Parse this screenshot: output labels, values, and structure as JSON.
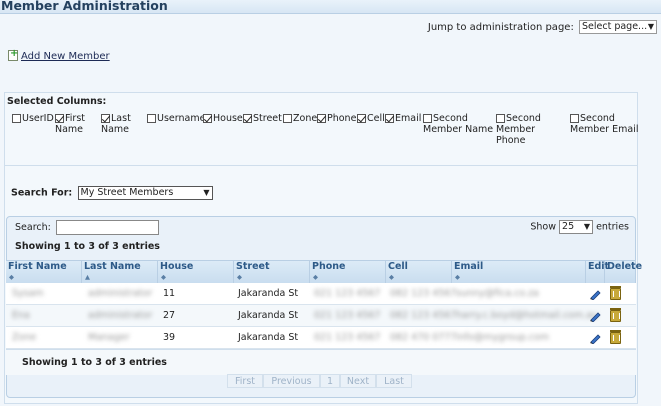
{
  "page": {
    "title": "Member Administration"
  },
  "jump": {
    "label": "Jump to administration page:",
    "selected": "Select page..."
  },
  "actions": {
    "add_member": "Add New Member"
  },
  "columns": {
    "label": "Selected Columns:",
    "items": [
      {
        "key": "userid",
        "lines": [
          "UserID"
        ],
        "checked": false
      },
      {
        "key": "first-name",
        "lines": [
          "First",
          "Name"
        ],
        "checked": true
      },
      {
        "key": "last-name",
        "lines": [
          "Last",
          "Name"
        ],
        "checked": true
      },
      {
        "key": "username",
        "lines": [
          "Username"
        ],
        "checked": false
      },
      {
        "key": "house",
        "lines": [
          "House"
        ],
        "checked": true
      },
      {
        "key": "street",
        "lines": [
          "Street"
        ],
        "checked": true
      },
      {
        "key": "zone",
        "lines": [
          "Zone"
        ],
        "checked": false
      },
      {
        "key": "phone",
        "lines": [
          "Phone"
        ],
        "checked": true
      },
      {
        "key": "cell",
        "lines": [
          "Cell"
        ],
        "checked": true
      },
      {
        "key": "email",
        "lines": [
          "Email"
        ],
        "checked": true
      },
      {
        "key": "second-member-name",
        "lines": [
          "Second",
          "Member Name"
        ],
        "checked": false
      },
      {
        "key": "second-member-phone",
        "lines": [
          "Second",
          "Member",
          "Phone"
        ],
        "checked": false
      },
      {
        "key": "second-member-email",
        "lines": [
          "Second",
          "Member Email"
        ],
        "checked": false
      }
    ]
  },
  "search_for": {
    "label": "Search For:",
    "selected": "My Street Members"
  },
  "table": {
    "search_label": "Search:",
    "show_label": "Show",
    "entries_value": "25",
    "entries_label": "entries",
    "info": "Showing 1 to 3 of 3 entries",
    "headers": [
      "First Name",
      "Last Name",
      "House",
      "Street",
      "Phone",
      "Cell",
      "Email",
      "Edit",
      "Delete"
    ],
    "rows": [
      {
        "first": "Sysam",
        "last": "administrator",
        "house": "11",
        "street": "Jakaranda St",
        "phone": "021 123 4567",
        "cell": "082 123 4567",
        "email": "sunny@fica.co.za"
      },
      {
        "first": "Ena",
        "last": "administrator",
        "house": "27",
        "street": "Jakaranda St",
        "phone": "021 123 4567",
        "cell": "082 123 4567",
        "email": "harry.c.boyd@hotmail.com.au"
      },
      {
        "first": "Zone",
        "last": "Manager",
        "house": "39",
        "street": "Jakaranda St",
        "phone": "021 123 4567",
        "cell": "082 470 0777",
        "email": "info@mygroup.com"
      }
    ],
    "pager": [
      "First",
      "Previous",
      "1",
      "Next",
      "Last"
    ]
  },
  "colors": {
    "accent": "#2d5a88",
    "title": "#24415f",
    "link": "#1d2a55"
  },
  "icons": {
    "add": "add-page-icon",
    "edit": "pencil-icon",
    "delete": "trash-icon"
  }
}
